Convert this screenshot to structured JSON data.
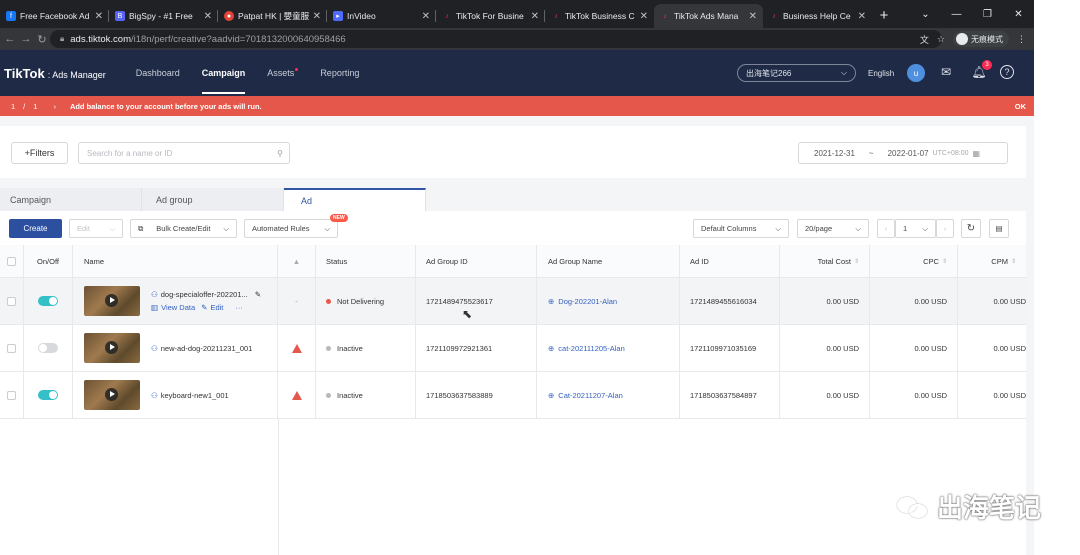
{
  "browser": {
    "tabs": [
      {
        "title": "Free Facebook Ad",
        "icon": "facebook-icon",
        "color": "#1877f2"
      },
      {
        "title": "BigSpy - #1 Free",
        "icon": "bigspy-icon",
        "color": "#5865f2"
      },
      {
        "title": "Patpat HK | 嬰童服",
        "icon": "patpat-icon",
        "color": "#e0453a"
      },
      {
        "title": "InVideo",
        "icon": "invideo-icon",
        "color": "#4f6bff"
      },
      {
        "title": "TikTok For Busine",
        "icon": "tiktok-icon",
        "color": "#fe2c55"
      },
      {
        "title": "TikTok Business C",
        "icon": "tiktok-icon",
        "color": "#fe2c55"
      },
      {
        "title": "TikTok Ads Mana",
        "icon": "tiktok-icon",
        "color": "#fe2c55"
      },
      {
        "title": "Business Help Ce",
        "icon": "tiktok-icon",
        "color": "#fe2c55"
      }
    ],
    "url_domain": "ads.tiktok.com",
    "url_path": "/i18n/perf/creative?aadvid=7018132000640958466",
    "incognito_label": "无痕模式"
  },
  "app": {
    "logo": "TikTok",
    "logo_sub": ": Ads Manager",
    "menu": [
      "Dashboard",
      "Campaign",
      "Assets",
      "Reporting"
    ],
    "account": "出海笔记266",
    "language": "English",
    "avatar_initial": "u",
    "notification_count": "3"
  },
  "notice": {
    "page_current": "1",
    "page_sep": "/",
    "page_total": "1",
    "message": "Add balance to your account before your ads will run.",
    "ok": "OK"
  },
  "filters": {
    "filters_label": "+Filters",
    "search_placeholder": "Search for a name or ID",
    "date_start": "2021-12-31",
    "date_sep": "~",
    "date_end": "2022-01-07",
    "timezone": "UTC+08:00"
  },
  "level_tabs": [
    "Campaign",
    "Ad group",
    "Ad"
  ],
  "toolbar": {
    "create": "Create",
    "edit": "Edit",
    "bulk": "Bulk Create/Edit",
    "rules": "Automated Rules",
    "new_badge": "NEW",
    "columns": "Default Columns",
    "per_page": "20/page",
    "page": "1"
  },
  "columns": [
    "On/Off",
    "Name",
    "Status",
    "Ad Group ID",
    "Ad Group Name",
    "Ad ID",
    "Total Cost",
    "CPC",
    "CPM"
  ],
  "rows": [
    {
      "on": true,
      "name": "dog-specialoffer-202201...",
      "actions": [
        "View Data",
        "Edit",
        "···"
      ],
      "alert": "-",
      "status": "Not Delivering",
      "status_color": "#e5574a",
      "ad_group_id": "1721489475523617",
      "ad_group_name": "Dog-202201-Alan",
      "ad_id": "1721489455616034",
      "total_cost": "0.00 USD",
      "cpc": "0.00 USD",
      "cpm": "0.00 USD"
    },
    {
      "on": false,
      "name": "new-ad-dog-20211231_001",
      "alert": "warning",
      "status": "Inactive",
      "status_color": "#b5b8bd",
      "ad_group_id": "1721109972921361",
      "ad_group_name": "cat-202111205-Alan",
      "ad_id": "1721109971035169",
      "total_cost": "0.00 USD",
      "cpc": "0.00 USD",
      "cpm": "0.00 USD"
    },
    {
      "on": true,
      "name": "keyboard-new1_001",
      "alert": "warning",
      "status": "Inactive",
      "status_color": "#b5b8bd",
      "ad_group_id": "1718503637583889",
      "ad_group_name": "Cat-20211207-Alan",
      "ad_id": "1718503637584897",
      "total_cost": "0.00 USD",
      "cpc": "0.00 USD",
      "cpm": "0.00 USD"
    }
  ],
  "watermark": "出海笔记"
}
